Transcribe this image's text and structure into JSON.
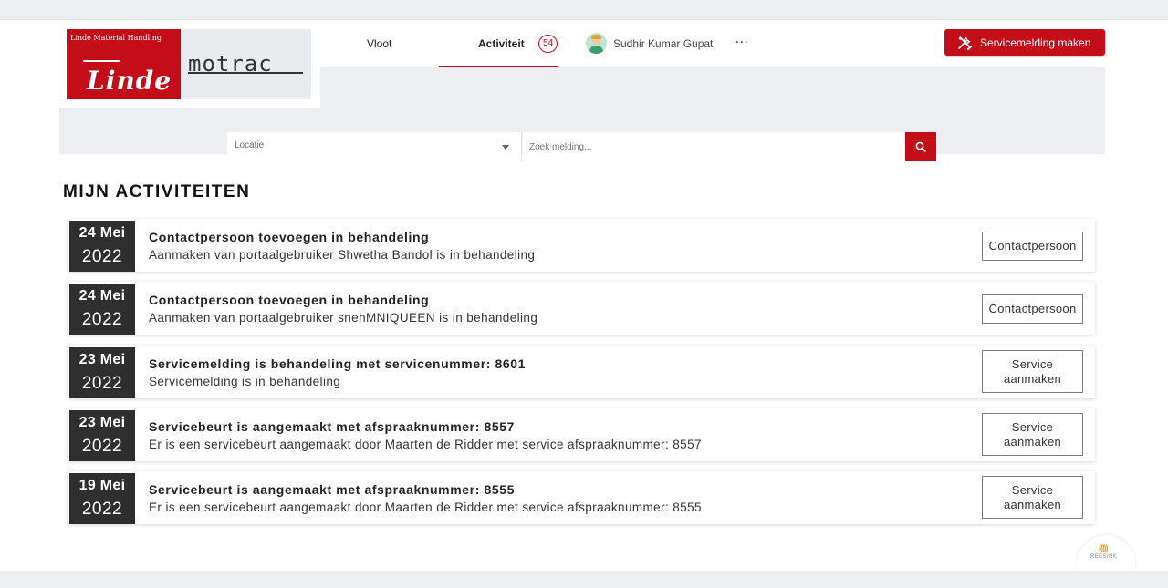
{
  "brand": {
    "linde_small": "Linde Material Handling",
    "linde_name": "Linde",
    "partner_name": "motrac"
  },
  "nav": {
    "vloot": "Vloot",
    "activiteit": "Activiteit",
    "activiteit_count": "54",
    "user_name": "Sudhir Kumar Gupat",
    "more": "···"
  },
  "header": {
    "service_button": "Servicemelding maken"
  },
  "filters": {
    "location_placeholder": "Locatie",
    "search_placeholder": "Zoek melding..."
  },
  "page": {
    "title": "MIJN ACTIVITEITEN"
  },
  "activities": [
    {
      "day": "24 Mei",
      "year": "2022",
      "title": "Contactpersoon toevoegen in behandeling",
      "description": "Aanmaken van portaalgebruiker Shwetha Bandol is in behandeling",
      "action": "Contactpersoon"
    },
    {
      "day": "24 Mei",
      "year": "2022",
      "title": "Contactpersoon toevoegen in behandeling",
      "description": "Aanmaken van portaalgebruiker snehMNIQUEEN is in behandeling",
      "action": "Contactpersoon"
    },
    {
      "day": "23 Mei",
      "year": "2022",
      "title": "Servicemelding is behandeling met servicenummer: 8601",
      "description": "Servicemelding is in behandeling",
      "action": "Service aanmaken"
    },
    {
      "day": "23 Mei",
      "year": "2022",
      "title": "Servicebeurt is aangemaakt met afspraaknummer: 8557",
      "description": "Er is een servicebeurt aangemaakt door Maarten de Ridder met service afspraaknummer: 8557",
      "action": "Service aanmaken"
    },
    {
      "day": "19 Mei",
      "year": "2022",
      "title": "Servicebeurt is aangemaakt met afspraaknummer: 8555",
      "description": "Er is een servicebeurt aangemaakt door Maarten de Ridder met service afspraaknummer: 8555",
      "action": "Service aanmaken"
    }
  ],
  "footer": {
    "badge_mark": "((|))",
    "badge_word": "REESINK"
  },
  "colors": {
    "accent": "#c30e1a",
    "date_box": "#2f2f2f",
    "background_strip": "#eceef1"
  },
  "icons": {
    "service_button": "tools-icon",
    "search_button": "search-icon",
    "location_dropdown": "caret-down-icon"
  }
}
